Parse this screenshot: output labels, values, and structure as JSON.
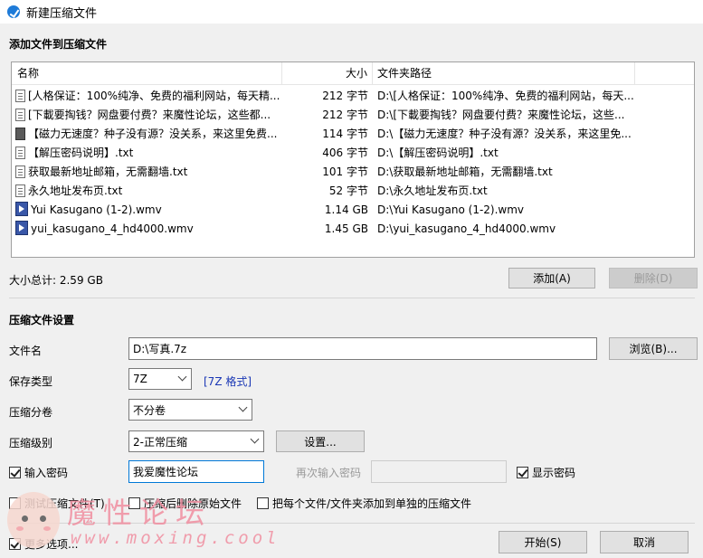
{
  "window": {
    "title": "新建压缩文件"
  },
  "add_section": {
    "heading": "添加文件到压缩文件"
  },
  "file_list": {
    "columns": [
      "名称",
      "大小",
      "文件夹路径"
    ],
    "rows": [
      {
        "icon": "text-file-icon",
        "name": "[人格保证：100%纯净、免费的福利网站，每天精...",
        "size": "212 字节",
        "path": "D:\\[人格保证：100%纯净、免费的福利网站，每天..."
      },
      {
        "icon": "text-file-icon",
        "name": "[下載要掏钱？网盘要付费？来魔性论坛，这些都...",
        "size": "212 字节",
        "path": "D:\\[下載要掏钱？网盘要付费？来魔性论坛，这些..."
      },
      {
        "icon": "exe-file-icon",
        "name": "【磁力无速度？种子没有源？没关系，来这里免费...",
        "size": "114 字节",
        "path": "D:\\【磁力无速度？种子没有源？没关系，来这里免..."
      },
      {
        "icon": "text-file-icon",
        "name": "【解压密码说明】.txt",
        "size": "406 字节",
        "path": "D:\\【解压密码说明】.txt"
      },
      {
        "icon": "text-file-icon",
        "name": "获取最新地址邮箱，无需翻墙.txt",
        "size": "101 字节",
        "path": "D:\\获取最新地址邮箱，无需翻墙.txt"
      },
      {
        "icon": "text-file-icon",
        "name": "永久地址发布页.txt",
        "size": "52 字节",
        "path": "D:\\永久地址发布页.txt"
      },
      {
        "icon": "wmv-file-icon",
        "name": "Yui Kasugano (1-2).wmv",
        "size": "1.14 GB",
        "path": "D:\\Yui Kasugano (1-2).wmv"
      },
      {
        "icon": "wmv-file-icon",
        "name": "yui_kasugano_4_hd4000.wmv",
        "size": "1.45 GB",
        "path": "D:\\yui_kasugano_4_hd4000.wmv"
      }
    ]
  },
  "total_size": "大小总计: 2.59 GB",
  "buttons": {
    "add": "添加(A)",
    "delete": "删除(D)",
    "browse": "浏览(B)...",
    "settings": "设置...",
    "start": "开始(S)",
    "cancel": "取消"
  },
  "settings_section": {
    "heading": "压缩文件设置",
    "filename_label": "文件名",
    "filename_value": "D:\\写真.7z",
    "type_label": "保存类型",
    "type_value": "7Z",
    "type_link": "[7Z 格式]",
    "split_label": "压缩分卷",
    "split_value": "不分卷",
    "level_label": "压缩级别",
    "level_value": "2-正常压缩"
  },
  "password": {
    "checkbox_label": "输入密码",
    "checked": true,
    "value": "我爱魔性论坛",
    "confirm_label": "再次输入密码",
    "confirm_value": "",
    "show_label": "显示密码",
    "show_checked": true
  },
  "options": {
    "test": {
      "label": "测试压缩文件(T)",
      "checked": false
    },
    "delete_after": {
      "label": "压缩后删除原始文件",
      "checked": false
    },
    "separate": {
      "label": "把每个文件/文件夹添加到单独的压缩文件",
      "checked": false
    },
    "more": {
      "label": "更多选项...",
      "checked": true
    }
  },
  "watermark": {
    "title": "魔性论坛",
    "url": "www.moxing.cool"
  },
  "colors": {
    "accent": "#0078d7",
    "link": "#1a37b5",
    "watermark": "#f08ea0"
  }
}
